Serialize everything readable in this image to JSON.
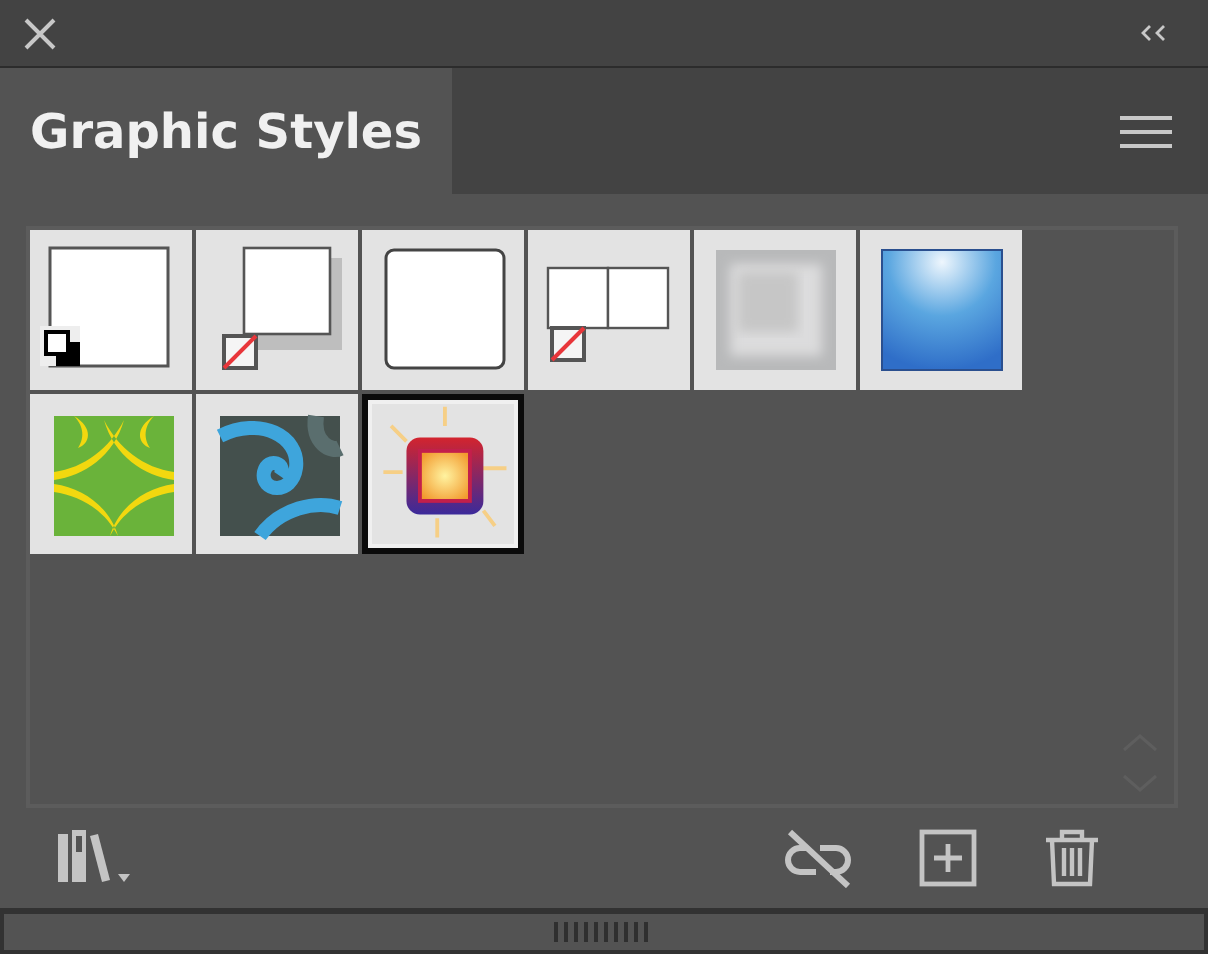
{
  "panel": {
    "tabs": [
      {
        "label": "Graphic Styles",
        "selected": true
      }
    ]
  },
  "styles": [
    {
      "kind": "default",
      "selected": false
    },
    {
      "kind": "shadow",
      "selected": false
    },
    {
      "kind": "rounded",
      "selected": false
    },
    {
      "kind": "split",
      "selected": false
    },
    {
      "kind": "blur",
      "selected": false
    },
    {
      "kind": "gloss",
      "selected": false
    },
    {
      "kind": "leaves",
      "selected": false
    },
    {
      "kind": "swirl",
      "selected": false
    },
    {
      "kind": "glow",
      "selected": true
    }
  ]
}
